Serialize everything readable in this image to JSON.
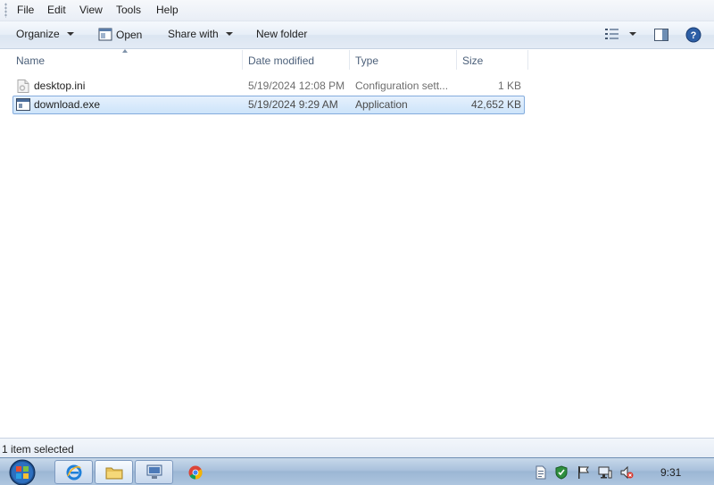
{
  "menu": [
    "File",
    "Edit",
    "View",
    "Tools",
    "Help"
  ],
  "toolbar": {
    "organize": "Organize",
    "open": "Open",
    "share_with": "Share with",
    "new_folder": "New folder"
  },
  "columns": [
    "Name",
    "Date modified",
    "Type",
    "Size"
  ],
  "files": [
    {
      "name": "desktop.ini",
      "date": "5/19/2024 12:08 PM",
      "type": "Configuration sett...",
      "size": "1 KB",
      "icon": "settings-file-icon",
      "selected": false
    },
    {
      "name": "download.exe",
      "date": "5/19/2024 9:29 AM",
      "type": "Application",
      "size": "42,652 KB",
      "icon": "application-icon",
      "selected": true
    }
  ],
  "status": {
    "text": "1 item selected"
  },
  "taskbar": {
    "clock": "9:31",
    "pinned": [
      "internet-explorer-icon",
      "folder-icon",
      "remote-desktop-icon",
      "chrome-icon"
    ],
    "tray": [
      "document-icon",
      "security-shield-icon",
      "flag-icon",
      "network-icon",
      "volume-muted-icon"
    ]
  },
  "colors": {
    "selection_fill": "#cde4fa",
    "selection_border": "#84acdd",
    "header_text": "#4c607a",
    "taskbar": "#a9c1dc"
  }
}
